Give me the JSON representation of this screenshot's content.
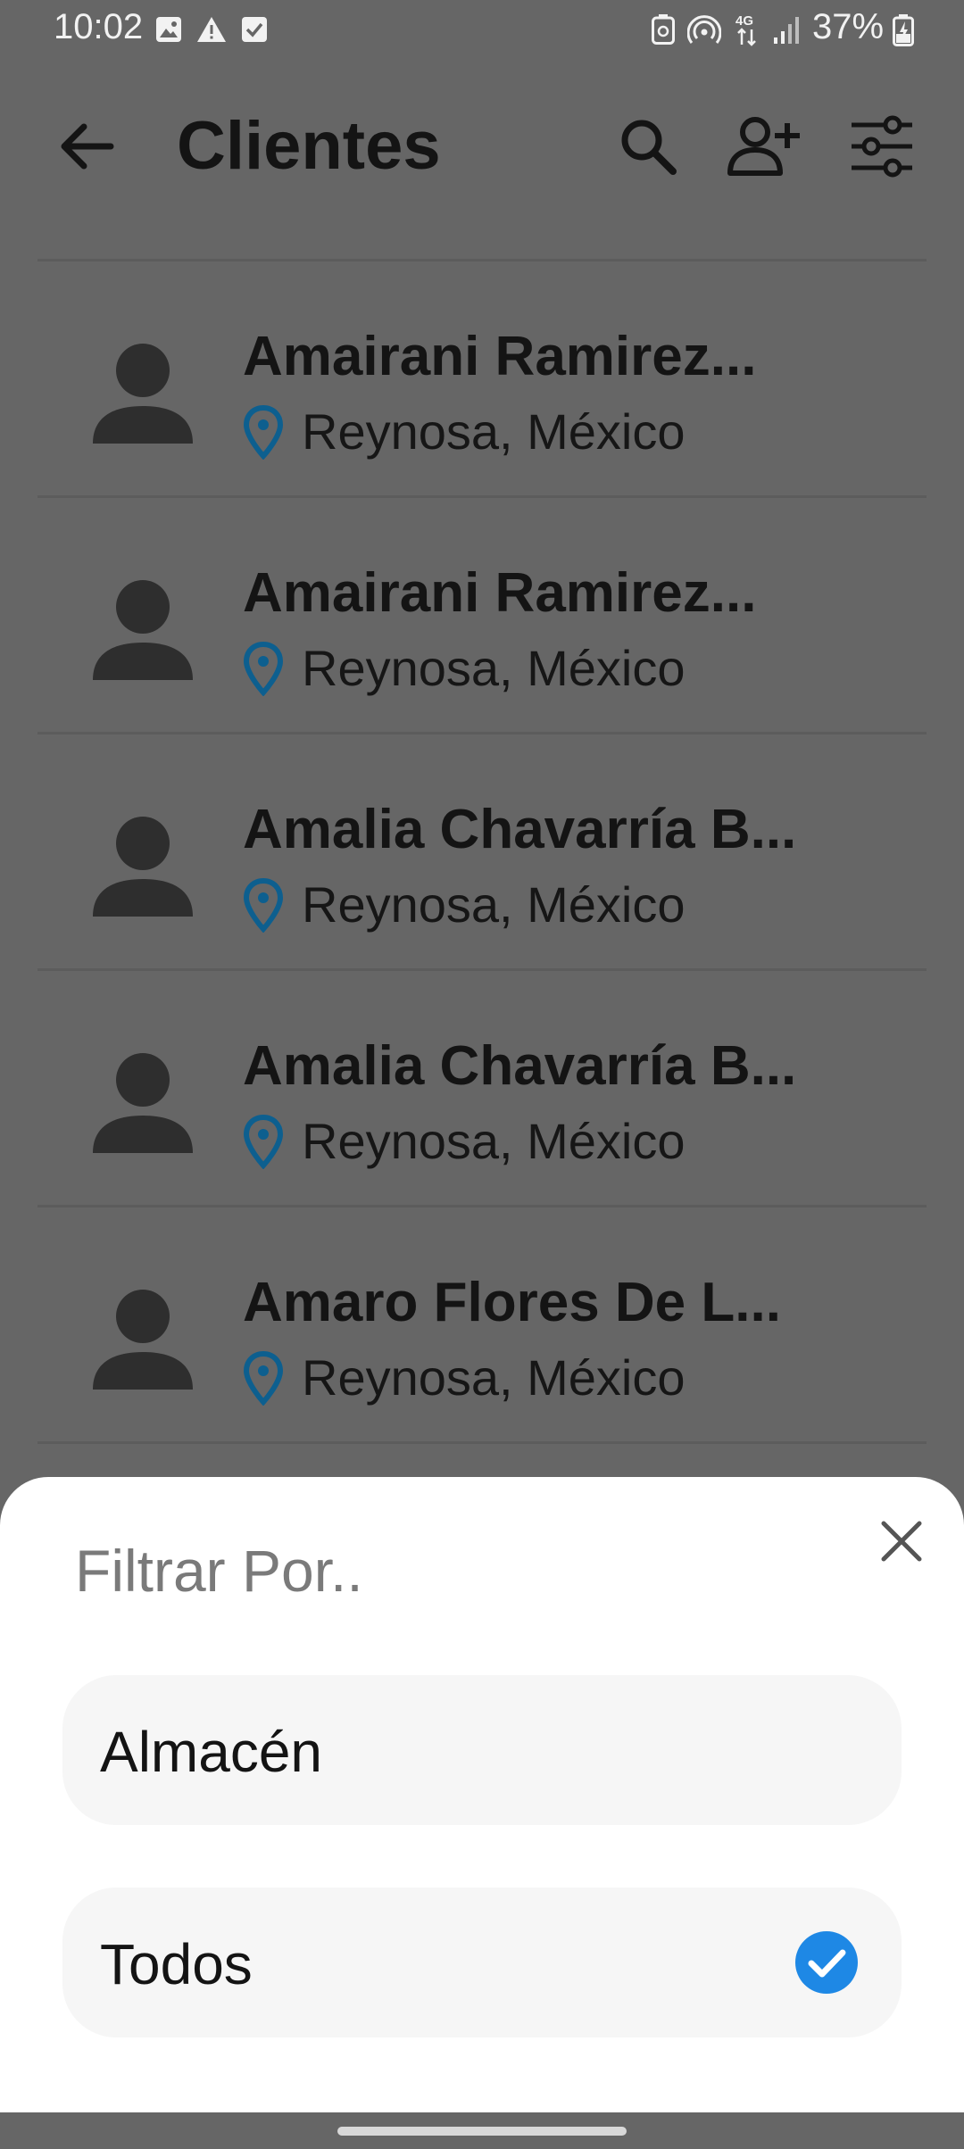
{
  "status_bar": {
    "time": "10:02",
    "network": "4G",
    "battery": "37%",
    "left_icons": [
      "image-icon",
      "warning-icon",
      "checkbox-icon"
    ],
    "right_icons": [
      "battery-saver-icon",
      "hotspot-icon",
      "network-4g-icon",
      "signal-icon"
    ]
  },
  "header": {
    "title": "Clientes",
    "icons": [
      "back-arrow-icon",
      "search-icon",
      "add-person-icon",
      "filter-sliders-icon"
    ]
  },
  "clients": [
    {
      "name": "Amairani Ramirez...",
      "location": "Reynosa, México"
    },
    {
      "name": "Amairani Ramirez...",
      "location": "Reynosa, México"
    },
    {
      "name": "Amalia Chavarría B...",
      "location": "Reynosa, México"
    },
    {
      "name": "Amalia Chavarría B...",
      "location": "Reynosa, México"
    },
    {
      "name": "Amaro Flores De L...",
      "location": "Reynosa, México"
    }
  ],
  "filter_sheet": {
    "title": "Filtrar Por..",
    "options": [
      {
        "label": "Almacén",
        "selected": false
      },
      {
        "label": "Todos",
        "selected": true
      }
    ]
  },
  "colors": {
    "scrim_background": "#666666",
    "pin_accent": "#0d5f8f",
    "check_accent": "#1e88e5",
    "sheet_background": "#ffffff",
    "option_background": "#f6f6f6"
  }
}
